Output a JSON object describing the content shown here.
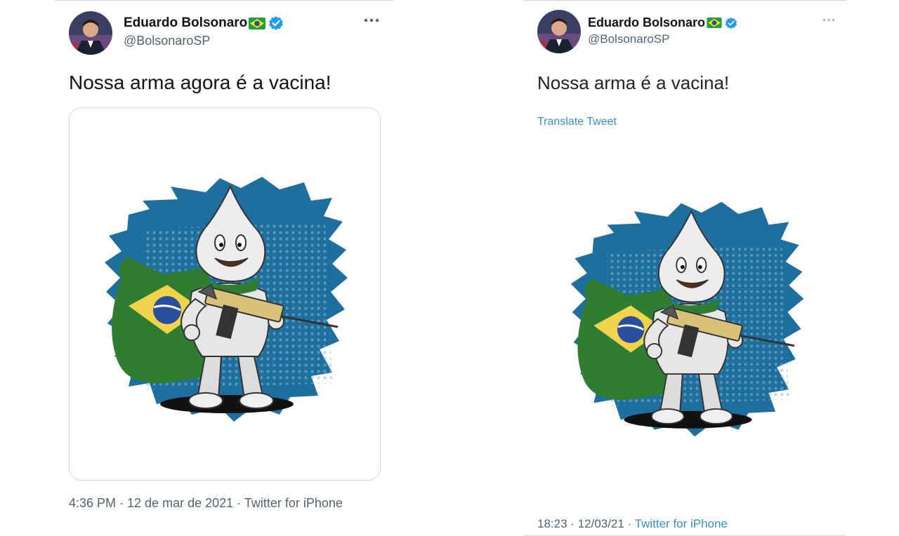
{
  "tweets": [
    {
      "author": {
        "name": "Eduardo Bolsonaro",
        "handle": "@BolsonaroSP"
      },
      "text": "Nossa arma agora é a vacina!",
      "timestamp": "4:36 PM · 12 de mar de 2021 · ",
      "source": "Twitter for iPhone"
    },
    {
      "author": {
        "name": "Eduardo Bolsonaro",
        "handle": "@BolsonaroSP"
      },
      "text": "Nossa arma é a vacina!",
      "translate_label": "Translate Tweet",
      "timestamp": "18:23 · 12/03/21 · ",
      "source": "Twitter for iPhone"
    }
  ],
  "icons": {
    "flag": "brazil-flag-icon",
    "verified": "verified-badge-icon",
    "more": "more-options-icon"
  },
  "colors": {
    "verified": "#1d9bf0",
    "link": "#3a8ec7",
    "secondary_text": "#536471",
    "border": "#cfd9de",
    "splash_blue": "#1f6f9e",
    "cape_green": "#2f7d32",
    "cape_yellow": "#f2d34c"
  }
}
